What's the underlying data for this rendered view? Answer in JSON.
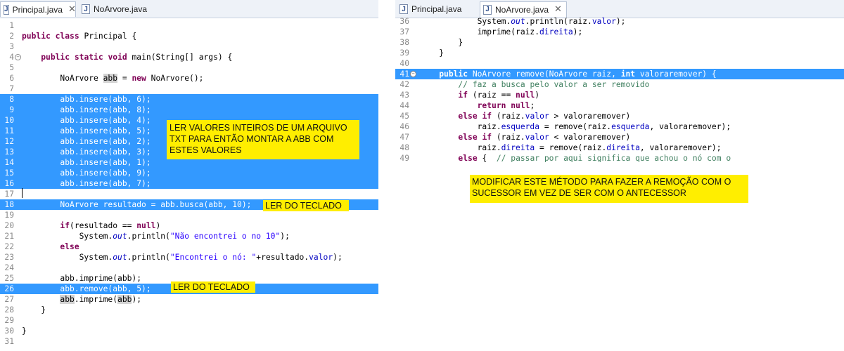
{
  "left": {
    "tabs": [
      {
        "label": "Principal.java",
        "close": "✕"
      },
      {
        "label": "NoArvore.java"
      }
    ],
    "lines": [
      {
        "n": "1"
      },
      {
        "n": "2",
        "parts": [
          {
            "t": "public",
            "c": "kw"
          },
          {
            "t": " "
          },
          {
            "t": "class",
            "c": "kw"
          },
          {
            "t": " Principal {"
          }
        ]
      },
      {
        "n": "3"
      },
      {
        "n": "4",
        "parts": [
          {
            "t": "    "
          },
          {
            "t": "public",
            "c": "kw"
          },
          {
            "t": " "
          },
          {
            "t": "static",
            "c": "kw"
          },
          {
            "t": " "
          },
          {
            "t": "void",
            "c": "kw"
          },
          {
            "t": " main(String[] args) {"
          }
        ]
      },
      {
        "n": "5"
      },
      {
        "n": "6",
        "parts": [
          {
            "t": "        NoArvore "
          },
          {
            "t": "abb",
            "c": "hl"
          },
          {
            "t": " = "
          },
          {
            "t": "new",
            "c": "kw"
          },
          {
            "t": " NoArvore();"
          }
        ]
      },
      {
        "n": "7"
      },
      {
        "n": "8",
        "parts": [
          {
            "t": "        abb.insere(abb, 6);"
          }
        ]
      },
      {
        "n": "9",
        "parts": [
          {
            "t": "        abb.insere(abb, 8);"
          }
        ]
      },
      {
        "n": "10",
        "parts": [
          {
            "t": "        abb.insere(abb, 4);"
          }
        ]
      },
      {
        "n": "11",
        "parts": [
          {
            "t": "        abb.insere(abb, 5);"
          }
        ]
      },
      {
        "n": "12",
        "parts": [
          {
            "t": "        abb.insere(abb, 2);"
          }
        ]
      },
      {
        "n": "13",
        "parts": [
          {
            "t": "        abb.insere(abb, 3);"
          }
        ]
      },
      {
        "n": "14",
        "parts": [
          {
            "t": "        abb.insere(abb, 1);"
          }
        ]
      },
      {
        "n": "15",
        "parts": [
          {
            "t": "        abb.insere(abb, 9);"
          }
        ]
      },
      {
        "n": "16",
        "parts": [
          {
            "t": "        abb.insere(abb, 7);"
          }
        ]
      },
      {
        "n": "17"
      },
      {
        "n": "18",
        "parts": [
          {
            "t": "        NoArvore resultado = abb.busca(abb, 10);"
          }
        ]
      },
      {
        "n": "19"
      },
      {
        "n": "20",
        "parts": [
          {
            "t": "        "
          },
          {
            "t": "if",
            "c": "kw"
          },
          {
            "t": "(resultado == "
          },
          {
            "t": "null",
            "c": "kw"
          },
          {
            "t": ")"
          }
        ]
      },
      {
        "n": "21",
        "parts": [
          {
            "t": "            System."
          },
          {
            "t": "out",
            "c": "fld it"
          },
          {
            "t": ".println("
          },
          {
            "t": "\"Não encontrei o no 10\"",
            "c": "str"
          },
          {
            "t": ");"
          }
        ]
      },
      {
        "n": "22",
        "parts": [
          {
            "t": "        "
          },
          {
            "t": "else",
            "c": "kw"
          }
        ]
      },
      {
        "n": "23",
        "parts": [
          {
            "t": "            System."
          },
          {
            "t": "out",
            "c": "fld it"
          },
          {
            "t": ".println("
          },
          {
            "t": "\"Encontrei o nó: \"",
            "c": "str"
          },
          {
            "t": "+resultado."
          },
          {
            "t": "valor",
            "c": "fld"
          },
          {
            "t": ");"
          }
        ]
      },
      {
        "n": "24"
      },
      {
        "n": "25",
        "parts": [
          {
            "t": "        abb.imprime(abb);"
          }
        ]
      },
      {
        "n": "26",
        "parts": [
          {
            "t": "        abb.remove(abb, 5);"
          }
        ]
      },
      {
        "n": "27",
        "parts": [
          {
            "t": "        "
          },
          {
            "t": "abb",
            "c": "hl"
          },
          {
            "t": ".imprime("
          },
          {
            "t": "abb",
            "c": "hl"
          },
          {
            "t": ");"
          }
        ]
      },
      {
        "n": "28",
        "parts": [
          {
            "t": "    }"
          }
        ]
      },
      {
        "n": "29"
      },
      {
        "n": "30",
        "parts": [
          {
            "t": "}"
          }
        ]
      },
      {
        "n": "31"
      }
    ],
    "notes": {
      "note1": "LER VALORES INTEIROS DE UM ARQUIVO TXT PARA ENTÃO MONTAR A ABB COM ESTES VALORES",
      "note2": "LER DO TECLADO",
      "note3": "LER DO TECLADO"
    }
  },
  "right": {
    "tabs": [
      {
        "label": "Principal.java"
      },
      {
        "label": "NoArvore.java",
        "close": "✕"
      }
    ],
    "lines": [
      {
        "n": "36",
        "parts": [
          {
            "t": "            System."
          },
          {
            "t": "out",
            "c": "fld it"
          },
          {
            "t": ".println(raiz."
          },
          {
            "t": "valor",
            "c": "fld"
          },
          {
            "t": ");"
          }
        ]
      },
      {
        "n": "37",
        "parts": [
          {
            "t": "            imprime(raiz."
          },
          {
            "t": "direita",
            "c": "fld"
          },
          {
            "t": ");"
          }
        ]
      },
      {
        "n": "38",
        "parts": [
          {
            "t": "        }"
          }
        ]
      },
      {
        "n": "39",
        "parts": [
          {
            "t": "    }"
          }
        ]
      },
      {
        "n": "40"
      },
      {
        "n": "41",
        "parts": [
          {
            "t": "    "
          },
          {
            "t": "public",
            "c": "kw"
          },
          {
            "t": " NoArvore remove(NoArvore raiz, "
          },
          {
            "t": "int",
            "c": "kw"
          },
          {
            "t": " valoraremover) {"
          }
        ]
      },
      {
        "n": "42",
        "parts": [
          {
            "t": "        "
          },
          {
            "t": "// faz a busca pelo valor a ser removido",
            "c": "cm"
          }
        ]
      },
      {
        "n": "43",
        "parts": [
          {
            "t": "        "
          },
          {
            "t": "if",
            "c": "kw"
          },
          {
            "t": " (raiz == "
          },
          {
            "t": "null",
            "c": "kw"
          },
          {
            "t": ")"
          }
        ]
      },
      {
        "n": "44",
        "parts": [
          {
            "t": "            "
          },
          {
            "t": "return",
            "c": "kw"
          },
          {
            "t": " "
          },
          {
            "t": "null",
            "c": "kw"
          },
          {
            "t": ";"
          }
        ]
      },
      {
        "n": "45",
        "parts": [
          {
            "t": "        "
          },
          {
            "t": "else",
            "c": "kw"
          },
          {
            "t": " "
          },
          {
            "t": "if",
            "c": "kw"
          },
          {
            "t": " (raiz."
          },
          {
            "t": "valor",
            "c": "fld"
          },
          {
            "t": " > valoraremover)"
          }
        ]
      },
      {
        "n": "46",
        "parts": [
          {
            "t": "            raiz."
          },
          {
            "t": "esquerda",
            "c": "fld"
          },
          {
            "t": " = remove(raiz."
          },
          {
            "t": "esquerda",
            "c": "fld"
          },
          {
            "t": ", valoraremover);"
          }
        ]
      },
      {
        "n": "47",
        "parts": [
          {
            "t": "        "
          },
          {
            "t": "else",
            "c": "kw"
          },
          {
            "t": " "
          },
          {
            "t": "if",
            "c": "kw"
          },
          {
            "t": " (raiz."
          },
          {
            "t": "valor",
            "c": "fld"
          },
          {
            "t": " < valoraremover)"
          }
        ]
      },
      {
        "n": "48",
        "parts": [
          {
            "t": "            raiz."
          },
          {
            "t": "direita",
            "c": "fld"
          },
          {
            "t": " = remove(raiz."
          },
          {
            "t": "direita",
            "c": "fld"
          },
          {
            "t": ", valoraremover);"
          }
        ]
      },
      {
        "n": "49",
        "parts": [
          {
            "t": "        "
          },
          {
            "t": "else",
            "c": "kw"
          },
          {
            "t": " {  "
          },
          {
            "t": "// passar por aqui significa que achou o nó com o",
            "c": "cm"
          }
        ]
      }
    ],
    "notes": {
      "note1": "MODIFICAR ESTE MÉTODO PARA FAZER A REMOÇÃO COM O SUCESSOR EM VEZ DE SER COM O ANTECESSOR"
    }
  }
}
